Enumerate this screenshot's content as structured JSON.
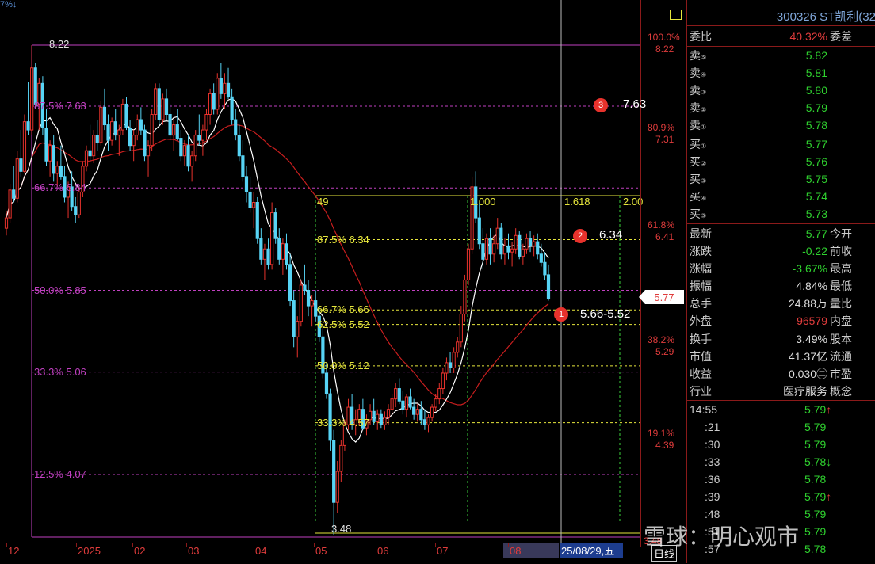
{
  "top_bar": {
    "fragment": "7%↓"
  },
  "chart_data": {
    "type": "candlestick",
    "x_ticks": [
      "12",
      "2025",
      "02",
      "03",
      "04",
      "05",
      "06",
      "07",
      "08"
    ],
    "cursor_date": "25/08/29,五",
    "y_axis_labels": [
      {
        "pct": "100.0%",
        "price": "8.22"
      },
      {
        "pct": "80.9%",
        "price": "7.31"
      },
      {
        "pct": "61.8%",
        "price": "6.41"
      },
      {
        "pct": "38.2%",
        "price": "5.29"
      },
      {
        "pct": "19.1%",
        "price": "4.39"
      },
      {
        "pct": "",
        "price": "3.48"
      }
    ],
    "current_price": "5.77",
    "high_label": "8.22",
    "low_label": "3.48",
    "fib_retracement_magenta": [
      {
        "label": "87.5% 7.63",
        "value": 7.63
      },
      {
        "label": "66.7% 6.84",
        "value": 6.84
      },
      {
        "label": "50.0% 5.85",
        "value": 5.85
      },
      {
        "label": "33.3% 5.06",
        "value": 5.06
      },
      {
        "label": "12.5% 4.07",
        "value": 4.07
      }
    ],
    "fib_retracement_yellow": [
      {
        "label": "87.5% 6.34",
        "value": 6.34
      },
      {
        "label": "66.7% 5.66",
        "value": 5.66
      },
      {
        "label": "62.5% 5.52",
        "value": 5.52
      },
      {
        "label": "50.0% 5.12",
        "value": 5.12
      },
      {
        "label": "33.3% 4.57",
        "value": 4.57
      }
    ],
    "fib_extension_labels": [
      "49",
      "1.000",
      "1.618",
      "2.00"
    ],
    "annotations": [
      {
        "num": "3",
        "text": "7.63"
      },
      {
        "num": "2",
        "text": "6.34"
      },
      {
        "num": "1",
        "text": "5.66-5.52"
      }
    ],
    "x_range": [
      0,
      166
    ],
    "y_range": [
      3.48,
      8.22
    ],
    "candles": [
      [
        6.45,
        6.62,
        6.38,
        6.55
      ],
      [
        6.55,
        6.88,
        6.5,
        6.82
      ],
      [
        6.82,
        7.05,
        6.7,
        6.74
      ],
      [
        6.74,
        7.2,
        6.7,
        7.12
      ],
      [
        7.12,
        7.4,
        6.95,
        7.0
      ],
      [
        7.0,
        7.55,
        6.98,
        7.48
      ],
      [
        7.48,
        7.86,
        7.35,
        7.4
      ],
      [
        7.4,
        8.22,
        7.35,
        8.0
      ],
      [
        8.0,
        8.05,
        7.6,
        7.65
      ],
      [
        7.65,
        7.9,
        7.4,
        7.85
      ],
      [
        7.85,
        7.92,
        7.35,
        7.42
      ],
      [
        7.42,
        7.6,
        7.05,
        7.1
      ],
      [
        7.1,
        7.3,
        6.95,
        7.25
      ],
      [
        7.25,
        7.35,
        6.9,
        6.98
      ],
      [
        6.98,
        7.1,
        6.85,
        7.05
      ],
      [
        7.05,
        7.25,
        6.92,
        6.95
      ],
      [
        6.95,
        7.05,
        6.7,
        6.75
      ],
      [
        6.75,
        6.9,
        6.55,
        6.85
      ],
      [
        6.85,
        7.0,
        6.62,
        6.66
      ],
      [
        6.66,
        6.75,
        6.5,
        6.58
      ],
      [
        6.58,
        6.85,
        6.55,
        6.8
      ],
      [
        6.8,
        7.1,
        6.75,
        7.05
      ],
      [
        7.05,
        7.25,
        7.0,
        7.2
      ],
      [
        7.2,
        7.45,
        7.1,
        7.15
      ],
      [
        7.15,
        7.4,
        7.08,
        7.35
      ],
      [
        7.35,
        7.5,
        7.2,
        7.28
      ],
      [
        7.28,
        7.68,
        7.25,
        7.62
      ],
      [
        7.62,
        7.8,
        7.4,
        7.45
      ],
      [
        7.45,
        7.55,
        7.2,
        7.3
      ],
      [
        7.3,
        7.52,
        7.25,
        7.48
      ],
      [
        7.48,
        7.6,
        7.3,
        7.35
      ],
      [
        7.35,
        7.45,
        7.15,
        7.4
      ],
      [
        7.4,
        7.7,
        7.35,
        7.65
      ],
      [
        7.65,
        7.72,
        7.4,
        7.42
      ],
      [
        7.42,
        7.5,
        7.2,
        7.25
      ],
      [
        7.25,
        7.4,
        7.1,
        7.35
      ],
      [
        7.35,
        7.55,
        7.3,
        7.5
      ],
      [
        7.5,
        7.62,
        7.35,
        7.4
      ],
      [
        7.4,
        7.45,
        7.1,
        7.15
      ],
      [
        7.15,
        7.3,
        6.95,
        7.25
      ],
      [
        7.25,
        7.6,
        7.2,
        7.55
      ],
      [
        7.55,
        7.85,
        7.5,
        7.8
      ],
      [
        7.8,
        7.85,
        7.45,
        7.5
      ],
      [
        7.5,
        7.75,
        7.45,
        7.7
      ],
      [
        7.7,
        7.8,
        7.5,
        7.55
      ],
      [
        7.55,
        7.65,
        7.3,
        7.35
      ],
      [
        7.35,
        7.5,
        7.2,
        7.45
      ],
      [
        7.45,
        7.6,
        7.3,
        7.32
      ],
      [
        7.32,
        7.4,
        7.1,
        7.15
      ],
      [
        7.15,
        7.3,
        7.05,
        7.25
      ],
      [
        7.25,
        7.35,
        7.0,
        7.05
      ],
      [
        7.05,
        7.2,
        6.9,
        7.15
      ],
      [
        7.15,
        7.4,
        7.1,
        7.35
      ],
      [
        7.35,
        7.55,
        7.25,
        7.3
      ],
      [
        7.3,
        7.45,
        7.15,
        7.4
      ],
      [
        7.4,
        7.6,
        7.3,
        7.55
      ],
      [
        7.55,
        7.8,
        7.45,
        7.75
      ],
      [
        7.75,
        7.85,
        7.55,
        7.6
      ],
      [
        7.6,
        7.95,
        7.55,
        7.9
      ],
      [
        7.9,
        8.05,
        7.7,
        7.75
      ],
      [
        7.75,
        7.95,
        7.6,
        7.85
      ],
      [
        7.85,
        8.0,
        7.7,
        7.72
      ],
      [
        7.72,
        7.8,
        7.45,
        7.5
      ],
      [
        7.5,
        7.6,
        7.3,
        7.35
      ],
      [
        7.35,
        7.45,
        7.1,
        7.15
      ],
      [
        7.15,
        7.3,
        6.9,
        6.95
      ],
      [
        6.95,
        7.05,
        6.7,
        6.8
      ],
      [
        6.8,
        6.95,
        6.6,
        6.65
      ],
      [
        6.65,
        6.8,
        6.45,
        6.7
      ],
      [
        6.7,
        6.75,
        6.3,
        6.35
      ],
      [
        6.35,
        6.45,
        6.1,
        6.15
      ],
      [
        6.15,
        6.3,
        5.95,
        6.25
      ],
      [
        6.25,
        6.35,
        6.05,
        6.1
      ],
      [
        6.1,
        6.7,
        6.05,
        6.6
      ],
      [
        6.6,
        6.65,
        6.3,
        6.35
      ],
      [
        6.35,
        6.45,
        6.1,
        6.15
      ],
      [
        6.15,
        6.35,
        6.0,
        6.3
      ],
      [
        6.3,
        6.4,
        6.05,
        6.1
      ],
      [
        6.1,
        6.2,
        5.7,
        5.75
      ],
      [
        5.75,
        5.85,
        5.3,
        5.4
      ],
      [
        5.4,
        5.6,
        5.2,
        5.55
      ],
      [
        5.55,
        5.95,
        5.5,
        5.9
      ],
      [
        5.9,
        6.1,
        5.8,
        5.85
      ],
      [
        5.85,
        5.95,
        5.6,
        5.7
      ],
      [
        5.7,
        5.8,
        5.5,
        5.75
      ],
      [
        5.75,
        5.85,
        5.55,
        5.6
      ],
      [
        5.6,
        5.7,
        5.35,
        5.4
      ],
      [
        5.4,
        5.5,
        5.0,
        5.05
      ],
      [
        5.05,
        5.15,
        4.8,
        4.85
      ],
      [
        4.85,
        4.9,
        4.3,
        4.4
      ],
      [
        4.4,
        4.5,
        3.48,
        3.8
      ],
      [
        3.8,
        4.2,
        3.7,
        4.1
      ],
      [
        4.1,
        4.4,
        4.0,
        4.35
      ],
      [
        4.35,
        4.6,
        4.3,
        4.55
      ],
      [
        4.55,
        4.8,
        4.5,
        4.72
      ],
      [
        4.72,
        4.85,
        4.5,
        4.55
      ],
      [
        4.55,
        4.7,
        4.45,
        4.6
      ],
      [
        4.6,
        4.75,
        4.55,
        4.7
      ],
      [
        4.7,
        4.8,
        4.5,
        4.52
      ],
      [
        4.52,
        4.65,
        4.45,
        4.6
      ],
      [
        4.6,
        4.75,
        4.55,
        4.68
      ],
      [
        4.68,
        4.8,
        4.55,
        4.58
      ],
      [
        4.58,
        4.7,
        4.5,
        4.65
      ],
      [
        4.65,
        4.7,
        4.52,
        4.55
      ],
      [
        4.55,
        4.68,
        4.5,
        4.62
      ],
      [
        4.62,
        4.75,
        4.55,
        4.7
      ],
      [
        4.7,
        4.85,
        4.65,
        4.8
      ],
      [
        4.8,
        4.95,
        4.72,
        4.9
      ],
      [
        4.9,
        5.0,
        4.75,
        4.78
      ],
      [
        4.78,
        4.88,
        4.65,
        4.7
      ],
      [
        4.7,
        4.85,
        4.62,
        4.82
      ],
      [
        4.82,
        4.9,
        4.7,
        4.72
      ],
      [
        4.72,
        4.8,
        4.6,
        4.65
      ],
      [
        4.65,
        4.75,
        4.58,
        4.7
      ],
      [
        4.7,
        4.78,
        4.55,
        4.6
      ],
      [
        4.6,
        4.7,
        4.5,
        4.55
      ],
      [
        4.55,
        4.65,
        4.48,
        4.62
      ],
      [
        4.62,
        4.75,
        4.58,
        4.72
      ],
      [
        4.72,
        4.85,
        4.68,
        4.8
      ],
      [
        4.8,
        4.95,
        4.75,
        4.9
      ],
      [
        4.9,
        5.1,
        4.85,
        5.05
      ],
      [
        5.05,
        5.2,
        4.98,
        5.15
      ],
      [
        5.15,
        5.25,
        5.05,
        5.1
      ],
      [
        5.1,
        5.3,
        5.05,
        5.25
      ],
      [
        5.25,
        5.4,
        5.2,
        5.35
      ],
      [
        5.35,
        5.7,
        5.3,
        5.62
      ],
      [
        5.62,
        6.0,
        5.55,
        5.95
      ],
      [
        5.95,
        6.3,
        5.9,
        6.25
      ],
      [
        6.25,
        6.95,
        6.2,
        6.85
      ],
      [
        6.85,
        7.0,
        6.5,
        6.55
      ],
      [
        6.55,
        6.7,
        6.25,
        6.3
      ],
      [
        6.3,
        6.45,
        6.05,
        6.15
      ],
      [
        6.15,
        6.4,
        6.1,
        6.35
      ],
      [
        6.35,
        6.45,
        6.1,
        6.2
      ],
      [
        6.2,
        6.38,
        6.12,
        6.3
      ],
      [
        6.3,
        6.55,
        6.25,
        6.45
      ],
      [
        6.45,
        6.5,
        6.15,
        6.2
      ],
      [
        6.2,
        6.35,
        6.1,
        6.28
      ],
      [
        6.28,
        6.4,
        6.15,
        6.22
      ],
      [
        6.22,
        6.32,
        6.08,
        6.25
      ],
      [
        6.25,
        6.45,
        6.2,
        6.38
      ],
      [
        6.38,
        6.42,
        6.15,
        6.18
      ],
      [
        6.18,
        6.3,
        6.1,
        6.25
      ],
      [
        6.25,
        6.4,
        6.2,
        6.35
      ],
      [
        6.35,
        6.42,
        6.22,
        6.28
      ],
      [
        6.28,
        6.38,
        6.18,
        6.32
      ],
      [
        6.32,
        6.4,
        6.15,
        6.2
      ],
      [
        6.2,
        6.3,
        6.08,
        6.12
      ],
      [
        6.12,
        6.22,
        5.95,
        6.0
      ],
      [
        6.0,
        6.1,
        5.75,
        5.77
      ]
    ]
  },
  "panel": {
    "header": "300326 ST凯利(32",
    "weibi": {
      "label": "委比",
      "value": "40.32%",
      "right": "委差"
    },
    "asks": [
      {
        "label": "卖",
        "n": "⑤",
        "value": "5.82"
      },
      {
        "label": "卖",
        "n": "④",
        "value": "5.81"
      },
      {
        "label": "卖",
        "n": "③",
        "value": "5.80"
      },
      {
        "label": "卖",
        "n": "②",
        "value": "5.79"
      },
      {
        "label": "卖",
        "n": "①",
        "value": "5.78"
      }
    ],
    "bids": [
      {
        "label": "买",
        "n": "①",
        "value": "5.77"
      },
      {
        "label": "买",
        "n": "②",
        "value": "5.76"
      },
      {
        "label": "买",
        "n": "③",
        "value": "5.75"
      },
      {
        "label": "买",
        "n": "④",
        "value": "5.74"
      },
      {
        "label": "买",
        "n": "⑤",
        "value": "5.73"
      }
    ],
    "stats": [
      {
        "label": "最新",
        "value": "5.77",
        "right": "今开",
        "color": "#2fd12f"
      },
      {
        "label": "涨跌",
        "value": "-0.22",
        "right": "前收",
        "color": "#2fd12f"
      },
      {
        "label": "涨幅",
        "value": "-3.67%",
        "right": "最高",
        "color": "#2fd12f"
      },
      {
        "label": "振幅",
        "value": "4.84%",
        "right": "最低",
        "color": "#dddddd"
      },
      {
        "label": "总手",
        "value": "24.88万",
        "right": "量比",
        "color": "#dddddd"
      },
      {
        "label": "外盘",
        "value": "96579",
        "right": "内盘",
        "color": "#e03c3c"
      }
    ],
    "stats2": [
      {
        "label": "换手",
        "value": "3.49%",
        "right": "股本",
        "color": "#dddddd"
      },
      {
        "label": "市值",
        "value": "41.37亿",
        "right": "流通",
        "color": "#dddddd"
      },
      {
        "label": "收益",
        "value": "0.030㊁",
        "right": "市盈",
        "color": "#dddddd"
      },
      {
        "label": "行业",
        "value": "医疗服务",
        "right": "概念",
        "color": "#dddddd"
      }
    ],
    "ticks": [
      {
        "time": "14:55",
        "price": "5.79",
        "arrow": "↑",
        "arrow_color": "#e03c3c"
      },
      {
        "time": ":21",
        "price": "5.79",
        "arrow": "",
        "arrow_color": ""
      },
      {
        "time": ":30",
        "price": "5.79",
        "arrow": "",
        "arrow_color": ""
      },
      {
        "time": ":33",
        "price": "5.78",
        "arrow": "↓",
        "arrow_color": "#2fd12f"
      },
      {
        "time": ":36",
        "price": "5.78",
        "arrow": "",
        "arrow_color": ""
      },
      {
        "time": ":39",
        "price": "5.79",
        "arrow": "↑",
        "arrow_color": "#e03c3c"
      },
      {
        "time": ":48",
        "price": "5.79",
        "arrow": "",
        "arrow_color": ""
      },
      {
        "time": ":51",
        "price": "5.79",
        "arrow": "",
        "arrow_color": ""
      },
      {
        "time": ":57",
        "price": "5.78",
        "arrow": "",
        "arrow_color": ""
      }
    ]
  },
  "bottom": {
    "daily_label": "日线",
    "low_axis": "3.48"
  },
  "watermark": "雪球：明心观市",
  "colors": {
    "up": "#e8322c",
    "down": "#57d4f5",
    "ma_short": "#ffffff",
    "ma_long": "#c81e1e",
    "fib_magenta": "#c040c0",
    "fib_yellow": "#e6e63c",
    "grid_green": "#3ad13a"
  }
}
